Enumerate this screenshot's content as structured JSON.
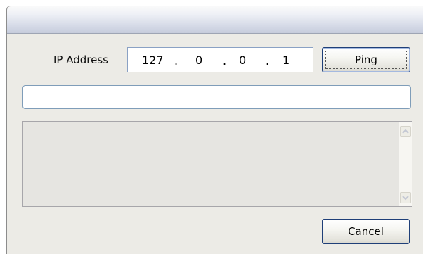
{
  "ip_address": {
    "label": "IP Address",
    "octets": [
      "127",
      "0",
      "0",
      "1"
    ],
    "separator": "."
  },
  "buttons": {
    "ping": "Ping",
    "cancel": "Cancel"
  },
  "status_field": {
    "value": ""
  },
  "icons": {
    "scroll_up": "chevron-up-icon",
    "scroll_down": "chevron-down-icon"
  }
}
